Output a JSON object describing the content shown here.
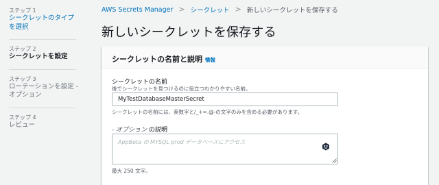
{
  "steps": [
    {
      "num": "ステップ 1",
      "label_line1": "シークレットのタイプ",
      "label_line2": "を選択"
    },
    {
      "num": "ステップ 2",
      "label_line1": "シークレットを設定"
    },
    {
      "num": "ステップ 3",
      "label_line1": "ローテーションを設定 -",
      "label_line2": "オプション"
    },
    {
      "num": "ステップ 4",
      "label_line1": "レビュー"
    }
  ],
  "breadcrumb": {
    "items": [
      "AWS Secrets Manager",
      "シークレット",
      "新しいシークレットを保存する"
    ],
    "separator": ">"
  },
  "page_title": "新しいシークレットを保存する",
  "panel": {
    "title": "シークレットの名前と説明",
    "info_link": "情報",
    "name_label": "シークレットの名前",
    "name_desc": "後でシークレットを見つけるのに役立つわかりやすい名前。",
    "name_value": "MyTestDatabaseMasterSecret",
    "name_constraint": "シークレットの名前には、英数字と/_+=.@-の文字のみを含める必要があります。",
    "desc_label_optional": "- オプション",
    "desc_label_main": "の説明",
    "desc_placeholder": "AppBeta の MYSQL prod データベースにアクセス",
    "max_note": "最大 250 文字。"
  },
  "colors": {
    "link": "#0073bb",
    "background": "#f2f3f3",
    "panel_header": "#fafafa"
  },
  "icons": {
    "assist": "assistant-hexagon-icon",
    "resize": "resize-grip-icon"
  }
}
